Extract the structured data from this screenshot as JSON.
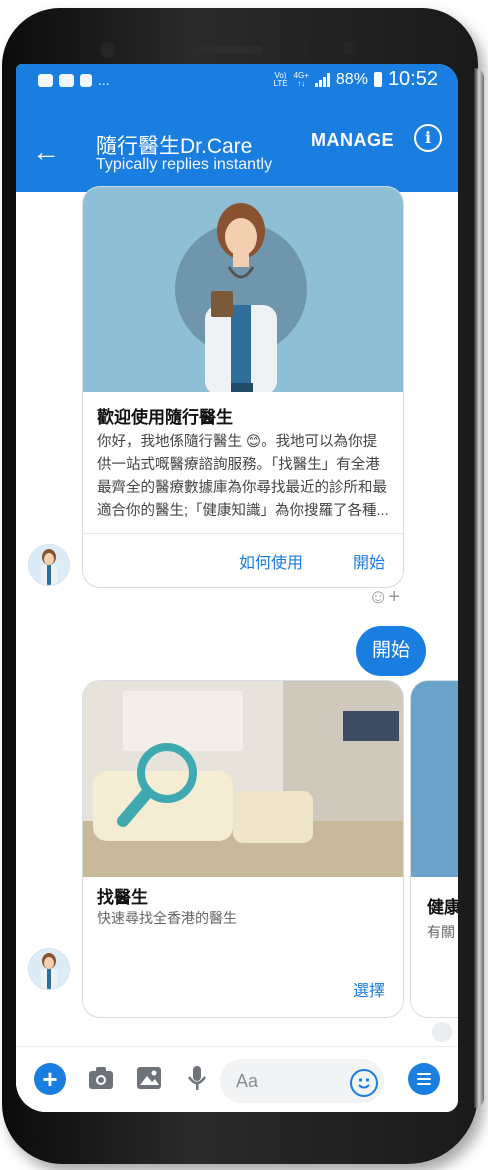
{
  "statusbar": {
    "net_top": "Vo)",
    "net_bottom": "LTE",
    "net2_top": "4G+",
    "net2_bottom": "↑↓",
    "battery": "88%",
    "time": "10:52",
    "notification_more": "..."
  },
  "header": {
    "back_icon": "←",
    "title": "隨行醫生Dr.Care",
    "subtitle": "Typically replies instantly",
    "manage": "MANAGE",
    "info_icon": "i"
  },
  "messages": {
    "welcome_card": {
      "title": "歡迎使用隨行醫生",
      "body": "你好，我地係隨行醫生 😊。我地可以為你提供一站式嘅醫療諮詢服務。「找醫生」有全港最齊全的醫療數據庫為你尋找最近的診所和最適合你的醫生;「健康知識」為你搜羅了各種...",
      "button_howto": "如何使用",
      "button_start": "開始"
    },
    "reaction_icon": "☺+",
    "user_reply": "開始",
    "carousel": [
      {
        "title": "找醫生",
        "subtitle": "快速尋找全香港的醫生",
        "button": "選擇"
      },
      {
        "title": "健康",
        "subtitle": "有關"
      }
    ]
  },
  "composer": {
    "plus_icon": "+",
    "placeholder": "Aa"
  },
  "colors": {
    "brand_blue": "#1a7de0",
    "card_border": "#d8dde3"
  }
}
